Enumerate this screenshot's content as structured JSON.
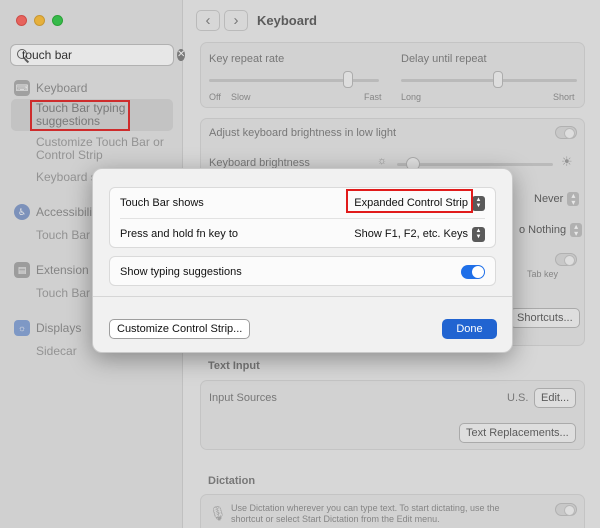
{
  "sidebar": {
    "search": {
      "value": "touch bar"
    },
    "sections": [
      {
        "label": "Keyboard",
        "items": [
          "Touch Bar typing suggestions",
          "Customize Touch Bar or Control Strip",
          "Keyboard s"
        ]
      },
      {
        "label": "Accessibili",
        "items": [
          "Touch Bar s"
        ]
      },
      {
        "label": "Extension",
        "items": [
          "Touch Bar"
        ]
      },
      {
        "label": "Displays",
        "items": [
          "Sidecar"
        ]
      }
    ]
  },
  "main": {
    "title": "Keyboard",
    "key_repeat": {
      "label": "Key repeat rate",
      "min": "Off",
      "slow": "Slow",
      "max": "Fast",
      "level": 0.82
    },
    "delay_repeat": {
      "label": "Delay until repeat",
      "min": "Long",
      "max": "Short",
      "level": 0.55
    },
    "adjust_brightness_label": "Adjust keyboard brightness in low light",
    "brightness_label": "Keyboard brightness",
    "turn_off_value": "Never",
    "press_value": "o Nothing",
    "tab_key_fragment": "Tab key",
    "shortcuts_button": "Shortcuts...",
    "text_input": {
      "title": "Text Input",
      "input_sources_label": "Input Sources",
      "input_sources_value": "U.S.",
      "edit_button": "Edit...",
      "replacements_button": "Text Replacements..."
    },
    "dictation": {
      "title": "Dictation",
      "description": "Use Dictation wherever you can type text. To start dictating, use the shortcut or select Start Dictation from the Edit menu."
    }
  },
  "dialog": {
    "touch_bar_shows_label": "Touch Bar shows",
    "touch_bar_shows_value": "Expanded Control Strip",
    "fn_key_label": "Press and hold fn key to",
    "fn_key_value": "Show F1, F2, etc. Keys",
    "typing_suggestions_label": "Show typing suggestions",
    "typing_suggestions_on": true,
    "customize_button": "Customize Control Strip...",
    "done_button": "Done"
  },
  "colors": {
    "accent": "#2164d1",
    "highlight_box": "#e11b1b"
  }
}
